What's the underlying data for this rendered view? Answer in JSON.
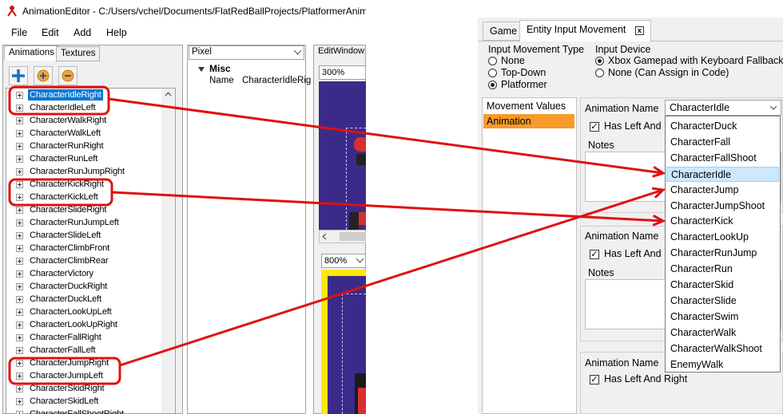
{
  "left_window": {
    "title": "AnimationEditor - C:/Users/vchel/Documents/FlatRedBallProjects/PlatformerAnim",
    "menu": [
      "File",
      "Edit",
      "Add",
      "Help"
    ],
    "tabs": [
      "Animations",
      "Textures"
    ],
    "animations": [
      "CharacterIdleRight",
      "CharacterIdleLeft",
      "CharacterWalkRight",
      "CharacterWalkLeft",
      "CharacterRunRight",
      "CharacterRunLeft",
      "CharacterRunJumpRight",
      "CharacterKickRight",
      "CharacterKickLeft",
      "CharacterSlideRight",
      "CharacterRunJumpLeft",
      "CharacterSlideLeft",
      "CharacterClimbFront",
      "CharacterClimbRear",
      "CharacterVictory",
      "CharacterDuckRight",
      "CharacterDuckLeft",
      "CharacterLookUpLeft",
      "CharacterLookUpRight",
      "CharacterFallRight",
      "CharacterFallLeft",
      "CharacterJumpRight",
      "CharacterJumpLeft",
      "CharacterSkidRight",
      "CharacterSkidLeft",
      "CharacterFallShootRight"
    ],
    "pixel_select": "Pixel",
    "property_category": "Misc",
    "property_name": "Name",
    "property_value": "CharacterIdleRig",
    "edit_window_label": "EditWindow",
    "zoom_top": "300%",
    "zoom_bottom": "800%"
  },
  "right_window": {
    "tabs": [
      "Game",
      "Entity Input Movement"
    ],
    "tab_close": "x",
    "input_movement_type_label": "Input Movement Type",
    "input_movement_options": [
      "None",
      "Top-Down",
      "Platformer"
    ],
    "input_device_label": "Input Device",
    "input_device_options": [
      "Xbox Gamepad with Keyboard Fallback",
      "None (Can Assign in Code)"
    ],
    "side_items": [
      "Movement Values",
      "Animation"
    ],
    "animation_name_label": "Animation Name",
    "animation_name_value": "CharacterIdle",
    "has_left_right_label": "Has Left And R",
    "has_left_right_full": "Has Left And Right",
    "notes_label": "Notes",
    "dropdown_items": [
      "CharacterDuck",
      "CharacterFall",
      "CharacterFallShoot",
      "CharacterIdle",
      "CharacterJump",
      "CharacterJumpShoot",
      "CharacterKick",
      "CharacterLookUp",
      "CharacterRunJump",
      "CharacterRun",
      "CharacterSkid",
      "CharacterSlide",
      "CharacterSwim",
      "CharacterWalk",
      "CharacterWalkShoot",
      "EnemyWalk"
    ]
  },
  "colors": {
    "annotation": "#e01010",
    "selection": "#0078d7",
    "sidebar_highlight": "#f79a2a",
    "sprite_bg": "#3c2a8a",
    "dropdown_highlight": "#cce8ff"
  }
}
